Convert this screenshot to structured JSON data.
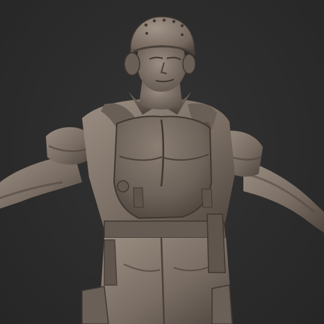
{
  "scene": {
    "subject": "clay-sculpt-soldier",
    "background_color": "#2b2b2b",
    "clay_base_color": "#7a6e64",
    "clay_highlight_color": "#9c8f84",
    "clay_shadow_color": "#4a413a"
  }
}
